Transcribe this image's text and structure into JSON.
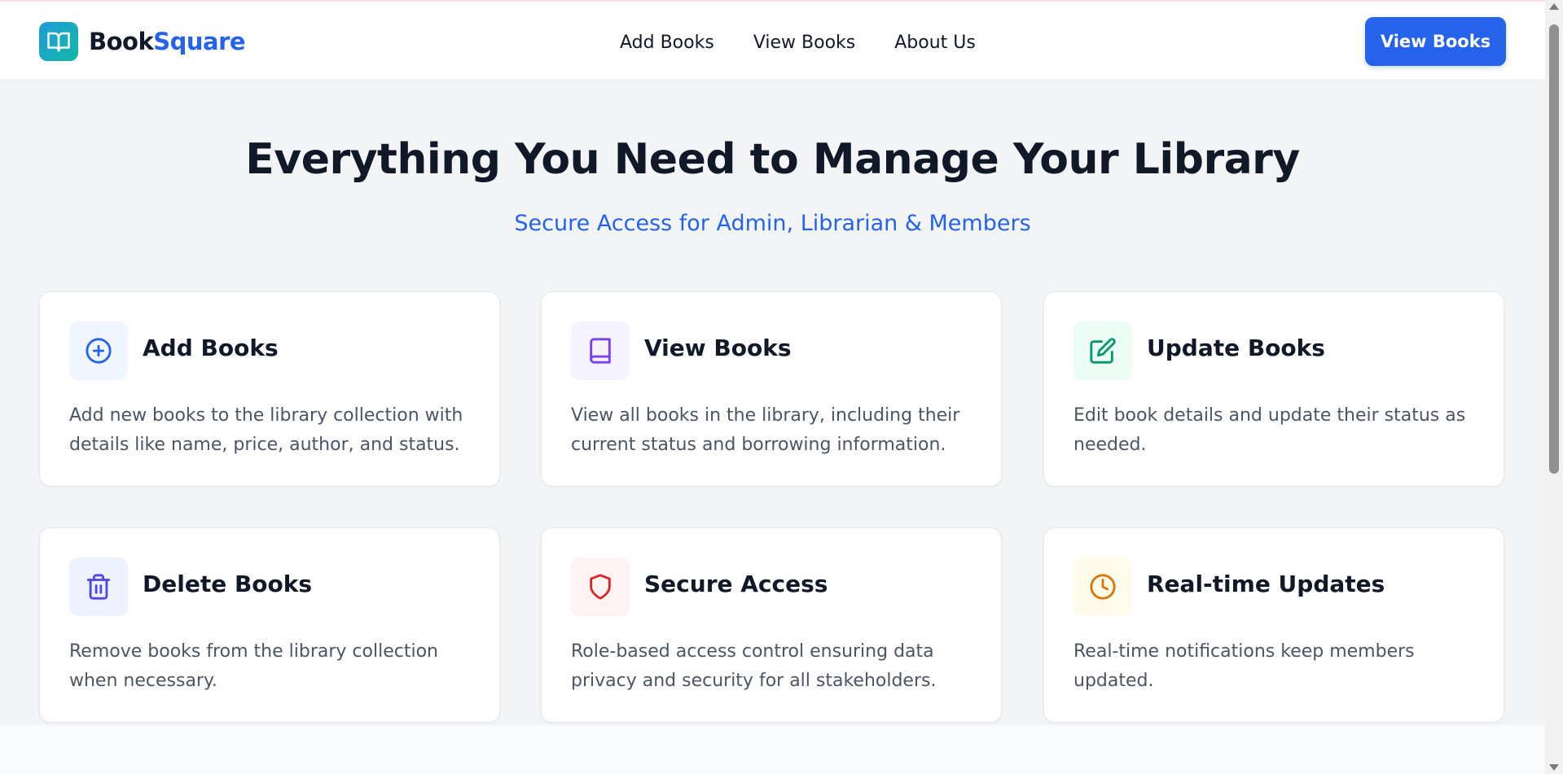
{
  "nav": {
    "brand_part1": "Book",
    "brand_part2": "Square",
    "links": [
      "Add Books",
      "View Books",
      "About Us"
    ],
    "cta_label": "View Books",
    "accent_color": "#2563eb"
  },
  "hero": {
    "title": "Everything You Need to Manage Your Library",
    "subtitle": "Secure Access for Admin, Librarian & Members"
  },
  "features": [
    {
      "icon": "plus-circle-icon",
      "title": "Add Books",
      "description": "Add new books to the library collection with details like name, price, author, and status.",
      "icon_color": "#2563eb",
      "icon_bg": "#eff6ff"
    },
    {
      "icon": "book-icon",
      "title": "View Books",
      "description": "View all books in the library, including their current status and borrowing information.",
      "icon_color": "#7e3ff2",
      "icon_bg": "#f5f3ff"
    },
    {
      "icon": "edit-icon",
      "title": "Update Books",
      "description": "Edit book details and update their status as needed.",
      "icon_color": "#059669",
      "icon_bg": "#ecfdf5"
    },
    {
      "icon": "trash-icon",
      "title": "Delete Books",
      "description": "Remove books from the library collection when necessary.",
      "icon_color": "#4f46e5",
      "icon_bg": "#eef2ff"
    },
    {
      "icon": "shield-icon",
      "title": "Secure Access",
      "description": "Role-based access control ensuring data privacy and security for all stakeholders.",
      "icon_color": "#dc2626",
      "icon_bg": "#fef2f2"
    },
    {
      "icon": "clock-icon",
      "title": "Real-time Updates",
      "description": "Real-time notifications keep members updated.",
      "icon_color": "#d97706",
      "icon_bg": "#fffbeb"
    }
  ]
}
